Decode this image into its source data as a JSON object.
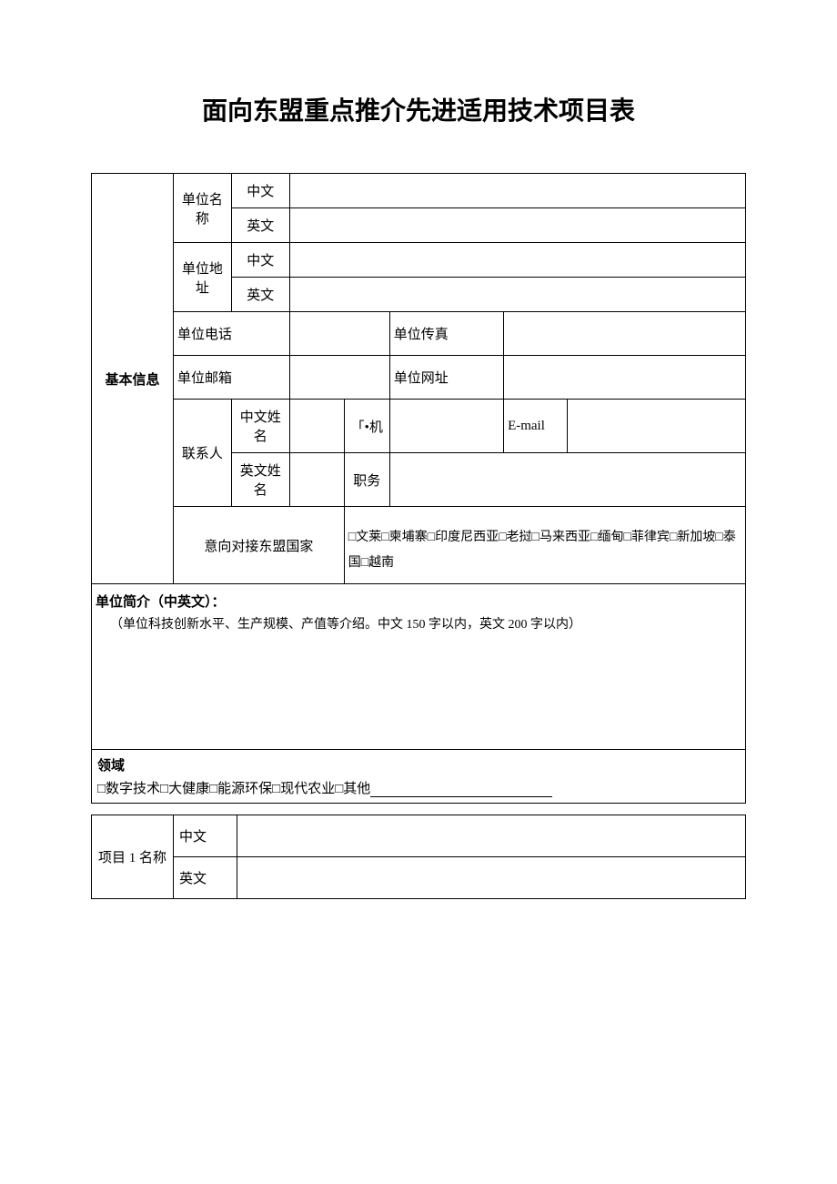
{
  "title": "面向东盟重点推介先进适用技术项目表",
  "labels": {
    "basicInfo": "基本信息",
    "unitName": "单位名称",
    "unitAddress": "单位地址",
    "chinese": "中文",
    "english": "英文",
    "unitPhone": "单位电话",
    "unitFax": "单位传真",
    "unitEmail": "单位邮箱",
    "unitWebsite": "单位网址",
    "contact": "联系人",
    "chineseName": "中文姓名",
    "englishName": "英文姓名",
    "mobile": "「•机",
    "position": "职务",
    "email": "E-mail",
    "targetCountriesLabel": "意向对接东盟国家",
    "targetCountries": "□文莱□柬埔寨□印度尼西亚□老挝□马来西亚□缅甸□菲律宾□新加坡□泰国□越南",
    "introTitle": "单位简介（中英文）：",
    "introHint": "（单位科技创新水平、生产规模、产值等介绍。中文 150 字以内，英文 200 字以内）",
    "domainTitle": "领域",
    "domainOptions": "□数字技术□大健康□能源环保□现代农业□其他",
    "project1Name": "项目 1 名称"
  }
}
